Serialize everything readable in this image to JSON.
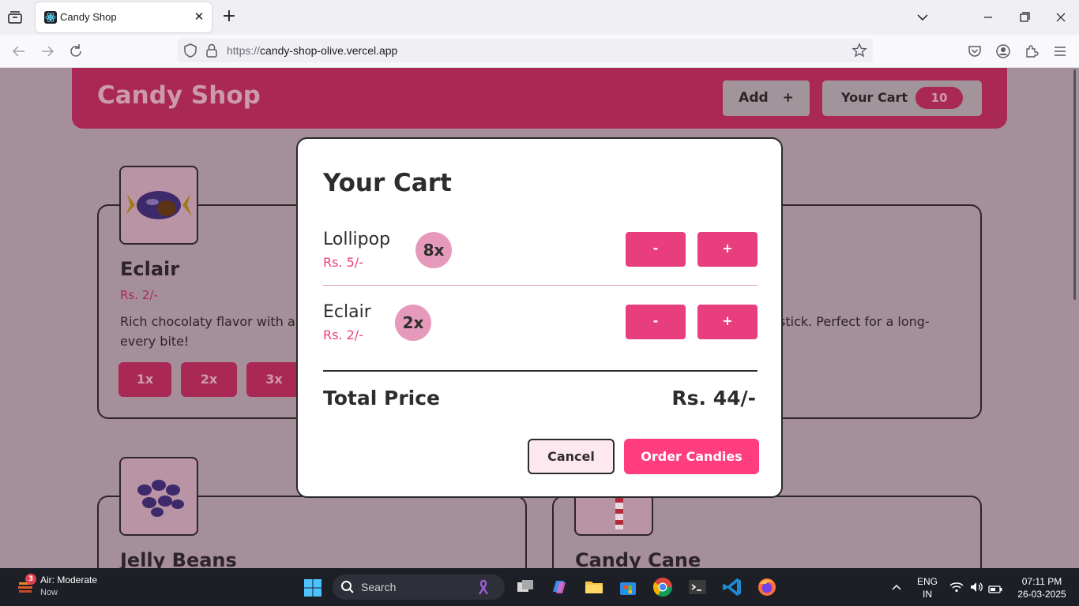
{
  "browser": {
    "tab_title": "Candy Shop",
    "url_prefix": "https://",
    "url_domain": "candy-shop-olive.vercel.app"
  },
  "header": {
    "brand": "Candy Shop",
    "add_label": "Add",
    "add_icon": "+",
    "cart_label": "Your Cart",
    "cart_count": "10"
  },
  "cards": [
    {
      "title": "Eclair",
      "price": "Rs. 2/-",
      "desc_left": "Rich chocolaty flavor with a",
      "desc_left2": "every bite!",
      "desc_right": "stick. Perfect for a long-",
      "qty_buttons": [
        "1x",
        "2x",
        "3x"
      ]
    },
    {
      "title": "Jelly Beans"
    },
    {
      "title": "Candy Cane"
    }
  ],
  "modal": {
    "title": "Your Cart",
    "items": [
      {
        "name": "Lollipop",
        "price": "Rs. 5/-",
        "qty": "8x",
        "minus": "-",
        "plus": "+"
      },
      {
        "name": "Eclair",
        "price": "Rs. 2/-",
        "qty": "2x",
        "minus": "-",
        "plus": "+"
      }
    ],
    "total_label": "Total Price",
    "total_value": "Rs. 44/-",
    "cancel": "Cancel",
    "order": "Order Candies"
  },
  "taskbar": {
    "weather_badge": "3",
    "weather_title": "Air: Moderate",
    "weather_sub": "Now",
    "search_placeholder": "Search",
    "lang1": "ENG",
    "lang2": "IN",
    "time": "07:11 PM",
    "date": "26-03-2025"
  }
}
